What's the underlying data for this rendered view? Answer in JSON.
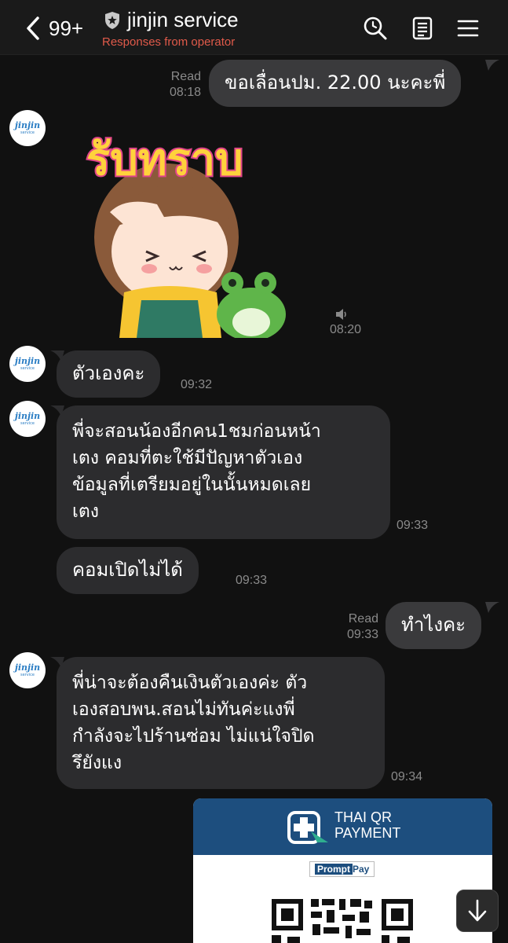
{
  "header": {
    "back_count": "99+",
    "title": "jinjin service",
    "subtitle": "Responses from operator",
    "icons": [
      "chevron-left-icon",
      "shield-star-icon",
      "search-icon",
      "notes-icon",
      "menu-icon"
    ]
  },
  "avatar": {
    "line1": "jinjin",
    "line2": "service"
  },
  "messages": [
    {
      "side": "out",
      "text": "ขอเลื่อนปม. 22.00 นะคะพี่",
      "status": "Read",
      "time": "08:18"
    },
    {
      "side": "in",
      "type": "sticker",
      "sticker_text": "รับทราบ",
      "time": "08:20"
    },
    {
      "side": "in",
      "text": "ตัวเองคะ",
      "time": "09:32"
    },
    {
      "side": "in",
      "lines": [
        "พี่จะสอนน้องอีกคน1ชมก่อนหน้า",
        "เตง คอมที่ตะใช้มีปัญหาตัวเอง",
        "ข้อมูลที่เตรียมอยู่ในนั้นหมดเลย",
        "เตง"
      ],
      "time": "09:33"
    },
    {
      "side": "in",
      "text": "คอมเปิดไม่ได้",
      "time": "09:33"
    },
    {
      "side": "out",
      "text": "ทำไงคะ",
      "status": "Read",
      "time": "09:33"
    },
    {
      "side": "in",
      "lines": [
        "พี่น่าจะต้องคืนเงินตัวเองค่ะ ตัว",
        "เองสอบพน.สอนไม่ทันค่ะแงพี่",
        "กำลังจะไปร้านซ่อม ไม่แน่ใจปิด",
        "รึยังแง"
      ],
      "time": "09:34"
    }
  ],
  "qr_card": {
    "brand_line1": "THAI QR",
    "brand_line2": "PAYMENT",
    "promptpay_a": "Prompt",
    "promptpay_b": "Pay"
  },
  "colors": {
    "background": "#111111",
    "bubble_in": "#2c2c2e",
    "bubble_out": "#3a3a3c",
    "subtitle_red": "#e05a4a",
    "qr_blue": "#1d4e7e"
  }
}
